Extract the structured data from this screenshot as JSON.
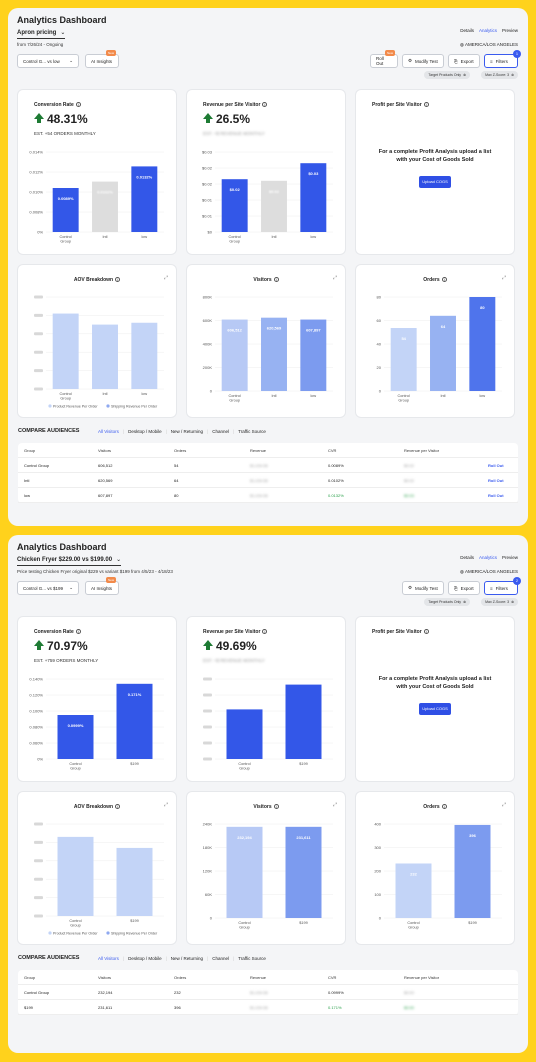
{
  "dashboards": [
    {
      "title": "Analytics Dashboard",
      "test_name": "Apron pricing",
      "subline": "from 7/26/24 - Ongoing",
      "links": [
        "Details",
        "Analytics",
        "Preview"
      ],
      "timezone": "AMERICA/LOS ANGELES",
      "control_select": "Control G... vs low",
      "ai_insights": "AI Insights",
      "new_badge": "New",
      "buttons": {
        "rollout": "Roll Out",
        "modify": "Modify Test",
        "export": "Export",
        "filters": "Filters",
        "filter_count": "1"
      },
      "chips": [
        "Target Products Only",
        "Max Z-Score: 3"
      ],
      "conversion": {
        "title": "Conversion Rate",
        "value": "48.31%",
        "sub": "EST. +54 ORDERS MONTHLY",
        "ticks": [
          "0.014%",
          "0.012%",
          "0.010%",
          "0.008%",
          "0%"
        ],
        "bars": [
          {
            "label": [
              "Control",
              "Group"
            ],
            "value": "0.0089%",
            "fill": 0.55,
            "color": "#3357E8"
          },
          {
            "label": [
              "Intl"
            ],
            "value": "0.0102%",
            "fill": 0.63,
            "color": "#DDDDDD",
            "blur": true
          },
          {
            "label": [
              "low"
            ],
            "value": "0.0132%",
            "fill": 0.82,
            "color": "#3357E8"
          }
        ]
      },
      "rpv": {
        "title": "Revenue per Site Visitor",
        "value": "26.5%",
        "sub": "EST. +$ REVENUE MONTHLY",
        "ticks": [
          "$0.03",
          "$0.02",
          "$0.02",
          "$0.01",
          "$0.01",
          "$0"
        ],
        "bars": [
          {
            "label": [
              "Control",
              "Group"
            ],
            "value": "$0.02",
            "fill": 0.66,
            "color": "#3357E8"
          },
          {
            "label": [
              "Intl"
            ],
            "value": "$0.02",
            "fill": 0.64,
            "color": "#DDDDDD",
            "blur": true
          },
          {
            "label": [
              "low"
            ],
            "value": "$0.03",
            "fill": 0.86,
            "color": "#3357E8"
          }
        ]
      },
      "profit": {
        "title": "Profit per Site Visitor",
        "cta": "For a complete Profit Analysis upload a list with your Cost of Goods Sold",
        "button": "Upload COGS"
      },
      "aov": {
        "title": "AOV Breakdown",
        "ticks": [
          "",
          "",
          "",
          "",
          "",
          ""
        ],
        "bars": [
          {
            "label": [
              "Control",
              "Group"
            ],
            "fill": 0.82,
            "color": "#C3D4F7"
          },
          {
            "label": [
              "Intl"
            ],
            "fill": 0.7,
            "color": "#C3D4F7"
          },
          {
            "label": [
              "low"
            ],
            "fill": 0.72,
            "color": "#C3D4F7"
          }
        ],
        "legend": [
          "Product Revenue Per Order",
          "Shipping Revenue Per Order"
        ]
      },
      "visitors": {
        "title": "Visitors",
        "ticks": [
          "800K",
          "600K",
          "400K",
          "200K",
          "0"
        ],
        "bars": [
          {
            "label": [
              "Control",
              "Group"
            ],
            "value": "606,512",
            "fill": 0.76,
            "color": "#B7C9F5"
          },
          {
            "label": [
              "Intl"
            ],
            "value": "620,569",
            "fill": 0.78,
            "color": "#97B2F2"
          },
          {
            "label": [
              "low"
            ],
            "value": "607,897",
            "fill": 0.76,
            "color": "#7C9BEF"
          }
        ]
      },
      "orders": {
        "title": "Orders",
        "ticks": [
          "80",
          "60",
          "40",
          "20",
          "0"
        ],
        "bars": [
          {
            "label": [
              "Control",
              "Group"
            ],
            "value": "54",
            "fill": 0.67,
            "color": "#C3D4F7"
          },
          {
            "label": [
              "Intl"
            ],
            "value": "64",
            "fill": 0.8,
            "color": "#97B2F2"
          },
          {
            "label": [
              "low"
            ],
            "value": "80",
            "fill": 1.0,
            "color": "#4F74EC"
          }
        ]
      },
      "compare": {
        "label": "COMPARE AUDIENCES",
        "tabs": [
          "All Visitors",
          "Desktop / Mobile",
          "New / Returning",
          "Channel",
          "Traffic Source"
        ],
        "headers": [
          "Group",
          "Visitors",
          "Orders",
          "Revenue",
          "CVR",
          "Revenue per Visitor",
          ""
        ],
        "rows": [
          {
            "group": "Control Group",
            "visitors": "606,512",
            "orders": "54",
            "revenue": "$1,234.56",
            "cvr": "0.0089%",
            "rpv": "$0.02",
            "action": "Roll Out",
            "green": false
          },
          {
            "group": "Intl",
            "visitors": "620,569",
            "orders": "64",
            "revenue": "$1,234.56",
            "cvr": "0.0102%",
            "rpv": "$0.02",
            "action": "Roll Out",
            "green": false
          },
          {
            "group": "low",
            "visitors": "607,897",
            "orders": "80",
            "revenue": "$1,234.56",
            "cvr": "0.0132%",
            "rpv": "$0.03",
            "action": "Roll Out",
            "green": true
          }
        ]
      }
    },
    {
      "title": "Analytics Dashboard",
      "test_name": "Chicken Fryer $229.00 vs $199.00",
      "subline": "Price testing Chicken Fryer original $229 vs variant $199 from 4/5/23 - 4/18/23",
      "links": [
        "Details",
        "Analytics",
        "Preview"
      ],
      "timezone": "AMERICA/LOS ANGELES",
      "control_select": "Control G... vs $199",
      "ai_insights": "AI Insights",
      "new_badge": "New",
      "buttons": {
        "modify": "Modify Test",
        "export": "Export",
        "filters": "Filters",
        "filter_count": "2"
      },
      "chips": [
        "Target Products Only",
        "Max Z-Score: 3"
      ],
      "conversion": {
        "title": "Conversion Rate",
        "value": "70.97%",
        "sub": "EST. +759 ORDERS MONTHLY",
        "ticks": [
          "0.140%",
          "0.120%",
          "0.100%",
          "0.080%",
          "0.060%",
          "0%"
        ],
        "bars": [
          {
            "label": [
              "Control",
              "Group"
            ],
            "value": "0.0999%",
            "fill": 0.55,
            "color": "#3357E8"
          },
          {
            "label": [
              "$199"
            ],
            "value": "0.171%",
            "fill": 0.94,
            "color": "#3357E8"
          }
        ]
      },
      "rpv": {
        "title": "Revenue per Site Visitor",
        "value": "49.69%",
        "sub": "EST. +$ REVENUE MONTHLY",
        "ticks": [
          "",
          "",
          "",
          "",
          "",
          ""
        ],
        "bars": [
          {
            "label": [
              "Control",
              "Group"
            ],
            "value": "",
            "fill": 0.62,
            "color": "#3357E8"
          },
          {
            "label": [
              "$199"
            ],
            "value": "",
            "fill": 0.93,
            "color": "#3357E8"
          }
        ]
      },
      "profit": {
        "title": "Profit per Site Visitor",
        "cta": "For a complete Profit Analysis upload a list with your Cost of Goods Sold",
        "button": "Upload COGS"
      },
      "aov": {
        "title": "AOV Breakdown",
        "ticks": [
          "",
          "",
          "",
          "",
          "",
          ""
        ],
        "bars": [
          {
            "label": [
              "Control",
              "Group"
            ],
            "fill": 0.86,
            "color": "#C3D4F7"
          },
          {
            "label": [
              "$199"
            ],
            "fill": 0.74,
            "color": "#C3D4F7"
          }
        ],
        "legend": [
          "Product Revenue Per Order",
          "Shipping Revenue Per Order"
        ]
      },
      "visitors": {
        "title": "Visitors",
        "ticks": [
          "240K",
          "180K",
          "120K",
          "60K",
          "0"
        ],
        "bars": [
          {
            "label": [
              "Control",
              "Group"
            ],
            "value": "232,194",
            "fill": 0.97,
            "color": "#B7C9F5"
          },
          {
            "label": [
              "$199"
            ],
            "value": "231,611",
            "fill": 0.97,
            "color": "#7C9BEF"
          }
        ]
      },
      "orders": {
        "title": "Orders",
        "ticks": [
          "400",
          "300",
          "200",
          "100",
          "0"
        ],
        "bars": [
          {
            "label": [
              "Control",
              "Group"
            ],
            "value": "232",
            "fill": 0.58,
            "color": "#C3D4F7"
          },
          {
            "label": [
              "$199"
            ],
            "value": "396",
            "fill": 0.99,
            "color": "#7C9BEF"
          }
        ]
      },
      "compare": {
        "label": "COMPARE AUDIENCES",
        "tabs": [
          "All Visitors",
          "Desktop / Mobile",
          "New / Returning",
          "Channel",
          "Traffic Source"
        ],
        "headers": [
          "Group",
          "Visitors",
          "Orders",
          "Revenue",
          "CVR",
          "Revenue per Visitor",
          ""
        ],
        "rows": [
          {
            "group": "Control Group",
            "visitors": "232,194",
            "orders": "232",
            "revenue": "$1,234.56",
            "cvr": "0.0999%",
            "rpv": "$0.00",
            "action": "",
            "green": false
          },
          {
            "group": "$199",
            "visitors": "231,611",
            "orders": "396",
            "revenue": "$1,234.56",
            "cvr": "0.171%",
            "rpv": "$0.00",
            "action": "",
            "green": true
          }
        ]
      }
    }
  ]
}
